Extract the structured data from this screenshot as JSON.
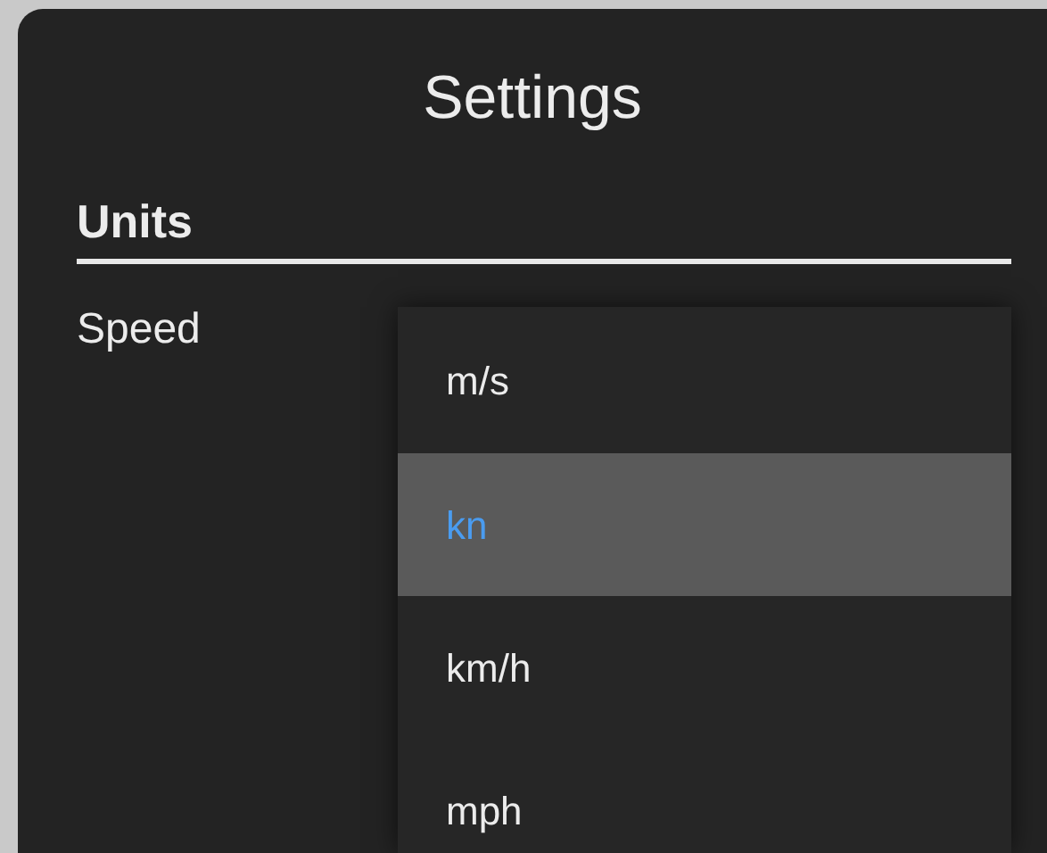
{
  "window": {
    "title": "Settings"
  },
  "section": {
    "title": "Units"
  },
  "field": {
    "label": "Speed"
  },
  "dropdown": {
    "options": [
      {
        "label": "m/s",
        "selected": false
      },
      {
        "label": "kn",
        "selected": true
      },
      {
        "label": "km/h",
        "selected": false
      },
      {
        "label": "mph",
        "selected": false
      }
    ]
  }
}
